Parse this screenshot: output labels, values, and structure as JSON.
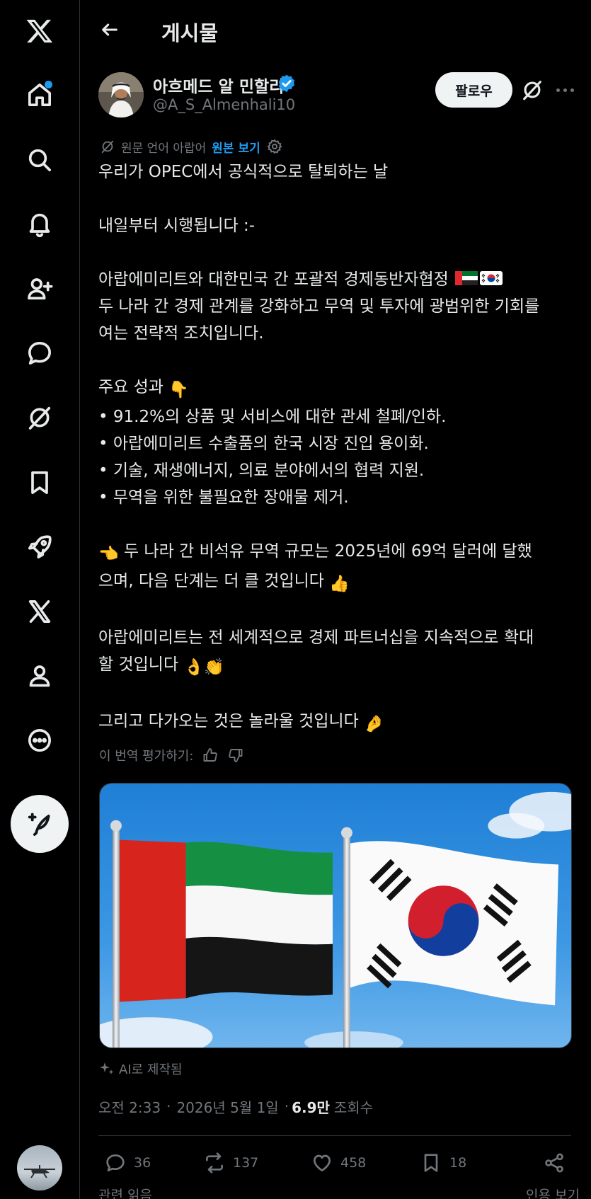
{
  "header": {
    "title": "게시물"
  },
  "author": {
    "name": "아흐메드 알 민할리",
    "handle": "@A_S_Almenhali10",
    "follow_label": "팔로우"
  },
  "translation": {
    "note": "원문 언어 아랍어",
    "show_original": "원본 보기"
  },
  "post": {
    "lines": [
      "우리가 OPEC에서 공식적으로 탈퇴하는 날",
      "",
      "내일부터 시행됩니다 :-",
      "",
      "아랍에미리트와 대한민국 간 포괄적 경제동반자협정",
      "두 나라 간 경제 관계를 강화하고 무역 및 투자에 광범위한 기회를",
      "여는 전략적 조치입니다.",
      "",
      "주요 성과",
      "• 91.2%의 상품 및 서비스에 대한 관세 철폐/인하.",
      "• 아랍에미리트 수출품의 한국 시장 진입 용이화.",
      "• 기술, 재생에너지, 의료 분야에서의 협력 지원.",
      "• 무역을 위한 불필요한 장애물 제거.",
      "",
      "두 나라 간 비석유 무역 규모는 2025년에 69억 달러에 달했",
      "으며, 다음 단계는 더 클 것입니다",
      "",
      "아랍에미리트는 전 세계적으로 경제 파트너십을 지속적으로 확대",
      "할 것입니다",
      "",
      "그리고 다가오는 것은 놀라울 것입니다"
    ],
    "emojis": {
      "flags": [
        "🇦🇪",
        "🇰🇷"
      ],
      "point_down": "👇",
      "point_left": "👈",
      "thumbs_up": "👍",
      "ok_hand": "👌",
      "clap": "👏",
      "pinch": "🤌"
    },
    "rate_translation": "이 번역 평가하기:",
    "ai_label": "AI로 제작됨",
    "time": "오전 2:33",
    "date": "2026년 5월 1일",
    "views": "6.9만",
    "views_label": "조회수"
  },
  "stats": {
    "replies": "36",
    "reposts": "137",
    "likes": "458",
    "bookmarks": "18"
  },
  "footer": {
    "related": "관련 읽음",
    "quotes": "인용 보기"
  },
  "nav": {
    "items": [
      "x-logo",
      "home",
      "search",
      "notifications",
      "follow",
      "messages",
      "grok",
      "bookmarks",
      "premium",
      "x",
      "profile",
      "more"
    ],
    "has_notification_dot": true
  },
  "colors": {
    "accent": "#1d9bf0",
    "background": "#000000",
    "text": "#e7e9ea",
    "muted": "#71767b",
    "verified": "#1d9bf0"
  }
}
